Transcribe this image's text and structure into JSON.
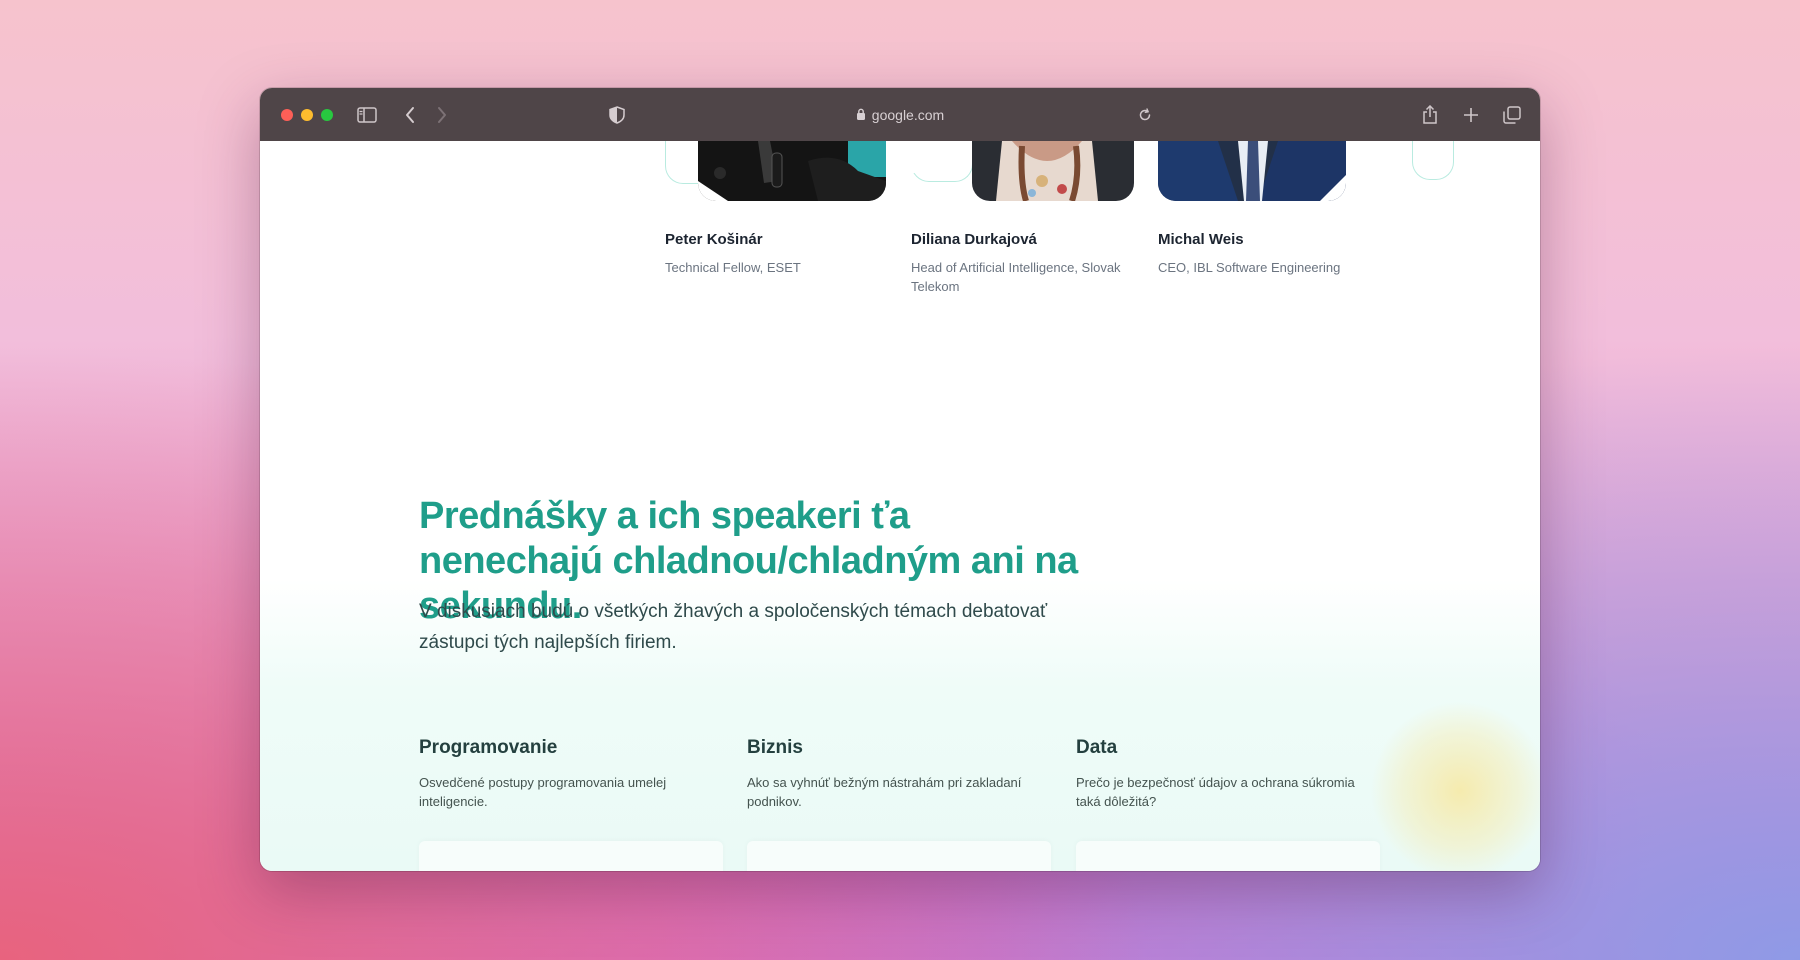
{
  "browser": {
    "url": "google.com",
    "icons": {
      "sidebar": "sidebar-icon",
      "back": "chevron-left-icon",
      "forward": "chevron-right-icon",
      "privacy": "shield-icon",
      "lock": "lock-icon",
      "reload": "reload-icon",
      "share": "share-icon",
      "new_tab": "plus-icon",
      "tabs": "tabs-overview-icon"
    },
    "colors": {
      "close": "#fe5f57",
      "minimize": "#febc2e",
      "maximize": "#28c840",
      "toolbar": "#4f4548"
    }
  },
  "speakers": [
    {
      "name": "Peter Košinár",
      "role": "Technical Fellow, ESET"
    },
    {
      "name": "Diliana Durkajová",
      "role": "Head of Artificial Intelligence, Slovak Telekom"
    },
    {
      "name": "Michal Weis",
      "role": "CEO, IBL Software Engineering"
    }
  ],
  "hero": {
    "headline": "Prednášky a ich speakeri ťa nenechajú chladnou/chladným ani na sekundu.",
    "subline": "V diskusiach budú o všetkých žhavých a spoločenských témach debatovať zástupci tých najlepších firiem."
  },
  "categories": [
    {
      "title": "Programovanie",
      "description": "Osvedčené postupy programovania umelej inteligencie."
    },
    {
      "title": "Biznis",
      "description": "Ako sa vyhnúť bežným nástrahám pri zakladaní podnikov."
    },
    {
      "title": "Data",
      "description": "Prečo je bezpečnosť údajov a ochrana súkromia taká dôležitá?"
    }
  ],
  "theme": {
    "accent": "#1f9e8a",
    "heading": "#24403f"
  }
}
